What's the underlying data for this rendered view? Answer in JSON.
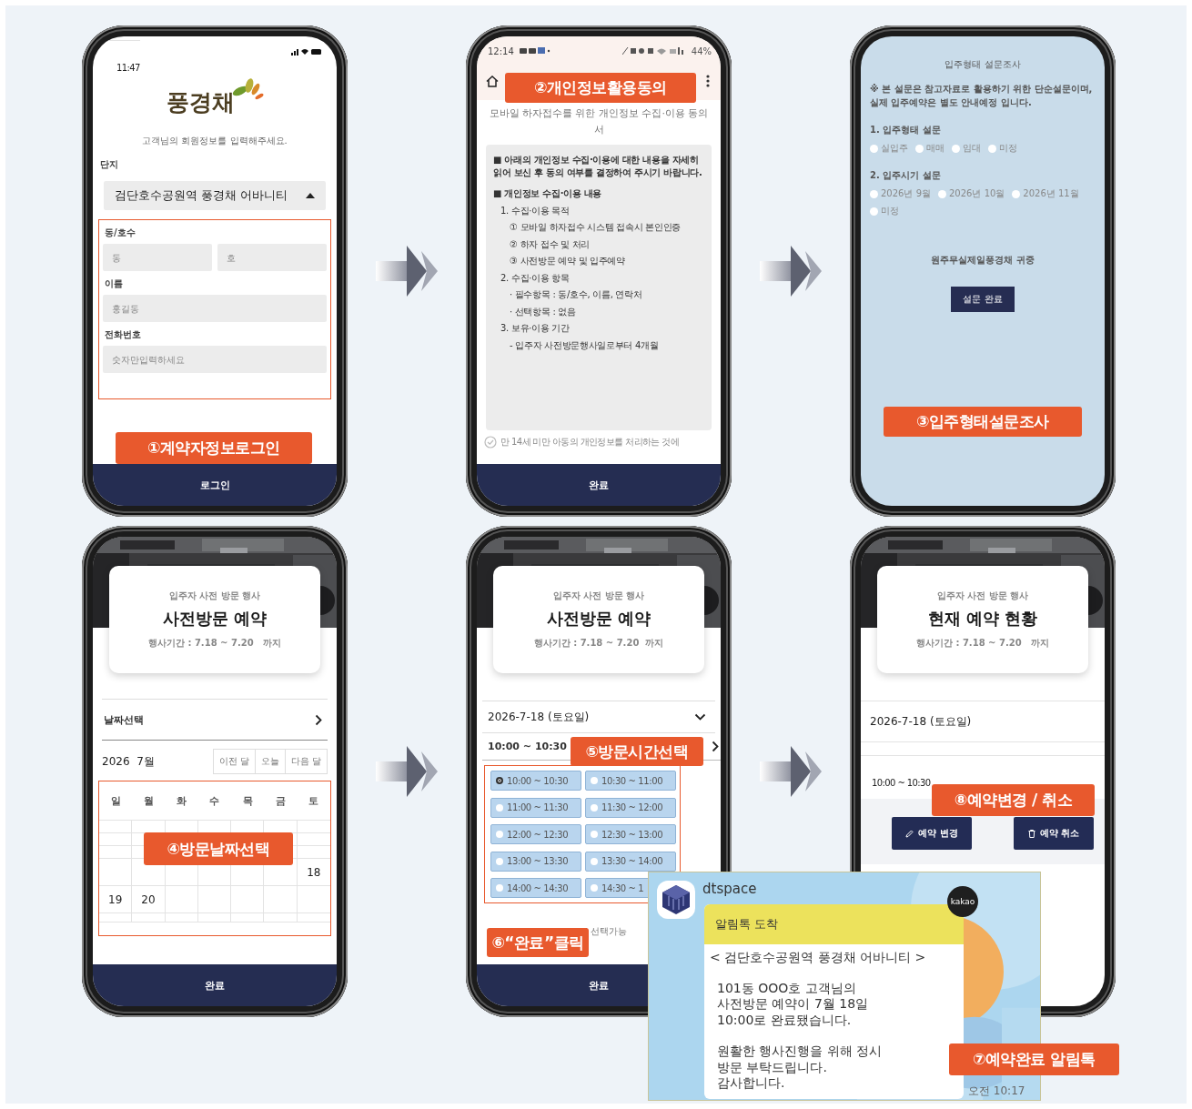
{
  "steps": [
    {
      "kind": "login",
      "callouts": [
        "①계약자정보로그인"
      ],
      "status_time": "11:47",
      "logo": "풍경채",
      "prompt": "고객님의 회원정보를 입력해주세요.",
      "complex": {
        "label": "단지",
        "value": "검단호수공원역 풍경채 어바니티",
        "expanded": true
      },
      "fields": [
        {
          "label": "동/호수",
          "inputs": [
            {
              "placeholder": "동"
            },
            {
              "placeholder": "호"
            }
          ]
        },
        {
          "label": "이름",
          "inputs": [
            {
              "placeholder": "홍길동"
            }
          ]
        },
        {
          "label": "전화번호",
          "inputs": [
            {
              "placeholder": "숫자만입력하세요"
            }
          ]
        }
      ],
      "button": "로그인"
    },
    {
      "kind": "consent",
      "callouts": [
        "②개인정보활용동의"
      ],
      "status_time": "12:14",
      "battery": "44%",
      "title": "모바일 하자접수를 위한 개인정보 수집·이용 동의서",
      "sections": [
        {
          "text": "■ 아래의 개인정보 수집·이용에 대한 내용을 자세히 읽어 보신 후 동의 여부를 결정하여 주시기 바랍니다."
        },
        {
          "text": "■ 개인정보 수집·이용 내용",
          "children": [
            {
              "text": "1. 수집·이용 목적",
              "children": [
                {
                  "text": "① 모바일 하자접수 시스템 접속시 본인인증"
                },
                {
                  "text": "② 하자 접수 및 처리"
                },
                {
                  "text": "③ 사전방문 예약 및 입주예약"
                }
              ]
            },
            {
              "text": "2. 수집·이용 항목",
              "children": [
                {
                  "text": "· 필수항목 : 동/호수, 이름, 연락처"
                },
                {
                  "text": "· 선택항목 : 없음"
                }
              ]
            },
            {
              "text": "3. 보유·이용 기간",
              "children": [
                {
                  "text": "- 입주자 사전방문행사일로부터 4개월"
                }
              ]
            }
          ]
        }
      ],
      "agreement": {
        "text": "만 14세 미만 아동의 개인정보를 처리하는 것에",
        "checked": false
      },
      "button": "완료"
    },
    {
      "kind": "survey",
      "callouts": [
        "③입주형태설문조사"
      ],
      "title": "입주형태 설문조사",
      "notice": "※ 본 설문은 참고자료로 활용하기 위한 단순설문이며, 실제 입주예약은 별도 안내예정 입니다.",
      "questions": [
        {
          "label": "1. 입주형태 설문",
          "options": [
            {
              "label": "실입주",
              "selected": false
            },
            {
              "label": "매매",
              "selected": false
            },
            {
              "label": "임대",
              "selected": false
            },
            {
              "label": "미정",
              "selected": false
            }
          ]
        },
        {
          "label": "2. 입주시기 설문",
          "options": [
            {
              "label": "2026년 9월",
              "selected": false
            },
            {
              "label": "2026년 10월",
              "selected": false
            },
            {
              "label": "2026년 11월",
              "selected": false
            },
            {
              "label": "미정",
              "selected": false
            }
          ]
        }
      ],
      "signature": "원주무실제일풍경채 귀중",
      "button": "설문 완료"
    },
    {
      "kind": "calendar",
      "callouts": [
        "④방문날짜선택"
      ],
      "card": {
        "subtitle": "입주자 사전 방문 행사",
        "title": "사전방문 예약",
        "period": "행사기간 : 7.18 ~ 7.20   까지"
      },
      "picker_label": "날짜선택",
      "month": "2026  7월",
      "nav": [
        "이전 달",
        "오늘",
        "다음 달"
      ],
      "weekdays": [
        "일",
        "월",
        "화",
        "수",
        "목",
        "금",
        "토"
      ],
      "dates": [
        "18",
        "19",
        "20"
      ],
      "button": "완료"
    },
    {
      "kind": "timeslots",
      "callouts": [
        "⑤방문시간선택",
        "⑥“완료”클릭"
      ],
      "card": {
        "subtitle": "입주자 사전 방문 행사",
        "title": "사전방문 예약",
        "period": "행사기간 : 7.18 ~ 7.20  까지"
      },
      "date": "2026-7-18 (토요일)",
      "time": "10:00 ~ 10:30",
      "slots": [
        {
          "label": "10:00 ~ 10:30",
          "selected": true
        },
        {
          "label": "10:30 ~ 11:00",
          "selected": false
        },
        {
          "label": "11:00 ~ 11:30",
          "selected": false
        },
        {
          "label": "11:30 ~ 12:00",
          "selected": false
        },
        {
          "label": "12:00 ~ 12:30",
          "selected": false
        },
        {
          "label": "12:30 ~ 13:00",
          "selected": false
        },
        {
          "label": "13:00 ~ 13:30",
          "selected": false
        },
        {
          "label": "13:30 ~ 14:00",
          "selected": false
        },
        {
          "label": "14:00 ~ 14:30",
          "selected": false
        },
        {
          "label": "14:30 ~ 1",
          "selected": false
        }
      ],
      "legend": "선택가능",
      "button": "완료"
    },
    {
      "kind": "status",
      "callouts": [
        "⑧예약변경 / 취소"
      ],
      "card": {
        "subtitle": "입주자 사전 방문 행사",
        "title": "현재 예약 현황",
        "period": "행사기간 : 7.18 ~ 7.20   까지"
      },
      "date": "2026-7-18 (토요일)",
      "time": "10:00 ~ 10:30",
      "actions": [
        {
          "label": "예약 변경",
          "kind": "edit"
        },
        {
          "label": "예약 취소",
          "kind": "delete"
        }
      ]
    }
  ],
  "notification": {
    "sender": "dtspace",
    "badge": "kakao",
    "header": "알림톡 도착",
    "paragraphs": [
      "< 검단호수공원역 풍경채 어바니티 >",
      "101동 OOO호 고객님의\n사전방문 예약이  7월 18일\n10:00로 완료됐습니다.",
      "원활한 행사진행을 위해 정시\n방문 부탁드립니다.\n감사합니다."
    ],
    "time": "오전 10:17",
    "callout": "⑦예약완료 알림톡"
  }
}
